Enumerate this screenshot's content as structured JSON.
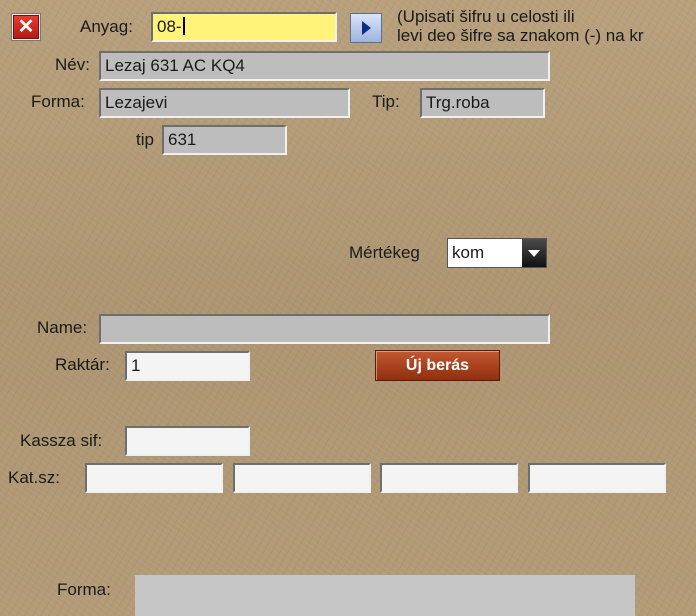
{
  "anyag": {
    "label": "Anyag:",
    "value": "08-"
  },
  "hint": {
    "line1": "(Upisati šifru u celosti ili",
    "line2": "levi deo šifre sa znakom (-) na kr"
  },
  "nev": {
    "label": "Név:",
    "value": "Lezaj 631 AC KQ4"
  },
  "forma": {
    "label": "Forma:",
    "value": "Lezajevi"
  },
  "tip": {
    "label": "Tip:",
    "value": "Trg.roba"
  },
  "tip2": {
    "label": "tip",
    "value": "631"
  },
  "mertekeg": {
    "label": "Mértékeg",
    "selected": "kom"
  },
  "name": {
    "label": "Name:",
    "value": ""
  },
  "raktar": {
    "label": "Raktár:",
    "value": "1"
  },
  "uj_beras": {
    "label": "Új berás"
  },
  "kassza": {
    "label": "Kassza sif:",
    "value": ""
  },
  "katsz": {
    "label": "Kat.sz:",
    "values": [
      "",
      "",
      "",
      ""
    ]
  },
  "forma2": {
    "label": "Forma:",
    "value": ""
  },
  "icons": {
    "close": "close-icon",
    "go": "play-arrow-icon",
    "dropdown": "chevron-down-icon"
  },
  "colors": {
    "background": "#b39b78",
    "input_highlight": "#fff37a",
    "button_accent": "#b04a22"
  }
}
